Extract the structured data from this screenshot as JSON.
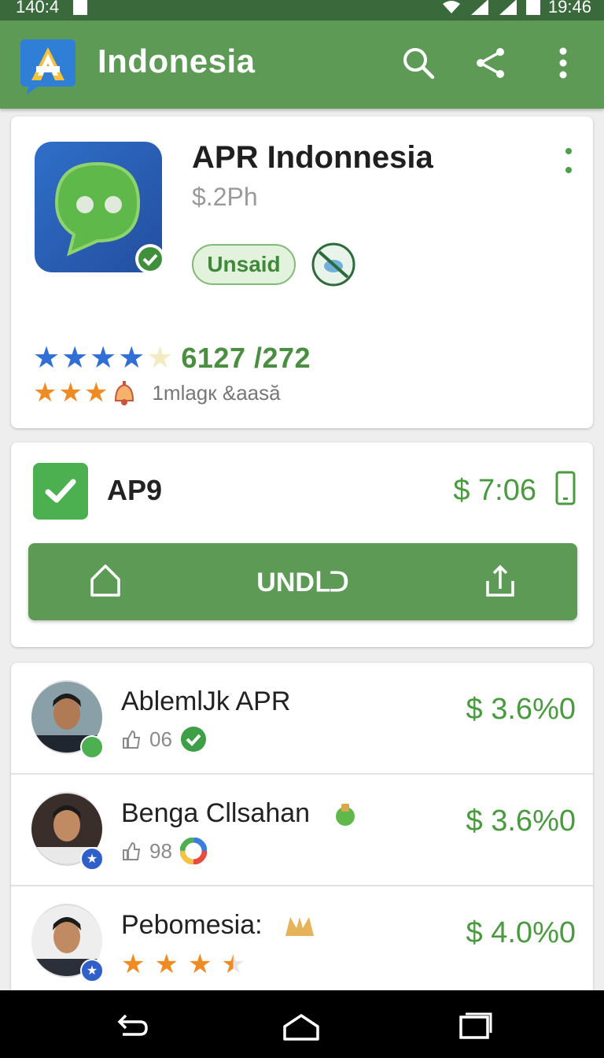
{
  "status_bar": {
    "left_text": "140:4",
    "time": "19:46"
  },
  "app_bar": {
    "title": "Indonesia"
  },
  "hero": {
    "title": "APR Indonnesia",
    "price": "$.2Ph",
    "status_chip": "Unsaid",
    "rating_count": "6127 /272",
    "rating_sub": "1mlagк &aasă",
    "rating_primary": 4,
    "rating_secondary": 3
  },
  "action": {
    "label": "AP9",
    "price": "$ 7:06",
    "button_label": "UNDᒪᑐ"
  },
  "list": [
    {
      "name": "AblemlJk APR",
      "meta": "06",
      "price": "$ 3.6%0"
    },
    {
      "name": "Benga Cllsahan",
      "meta": "98",
      "price": "$ 3.6%0"
    },
    {
      "name": "Pebomesia:",
      "meta": "",
      "price": "$ 4.0%0",
      "rating": 3.5
    }
  ],
  "colors": {
    "app_bar": "#5c9a56",
    "accent_green": "#4a9a3f",
    "star_blue": "#2f6fd6",
    "star_orange": "#f08a22"
  }
}
